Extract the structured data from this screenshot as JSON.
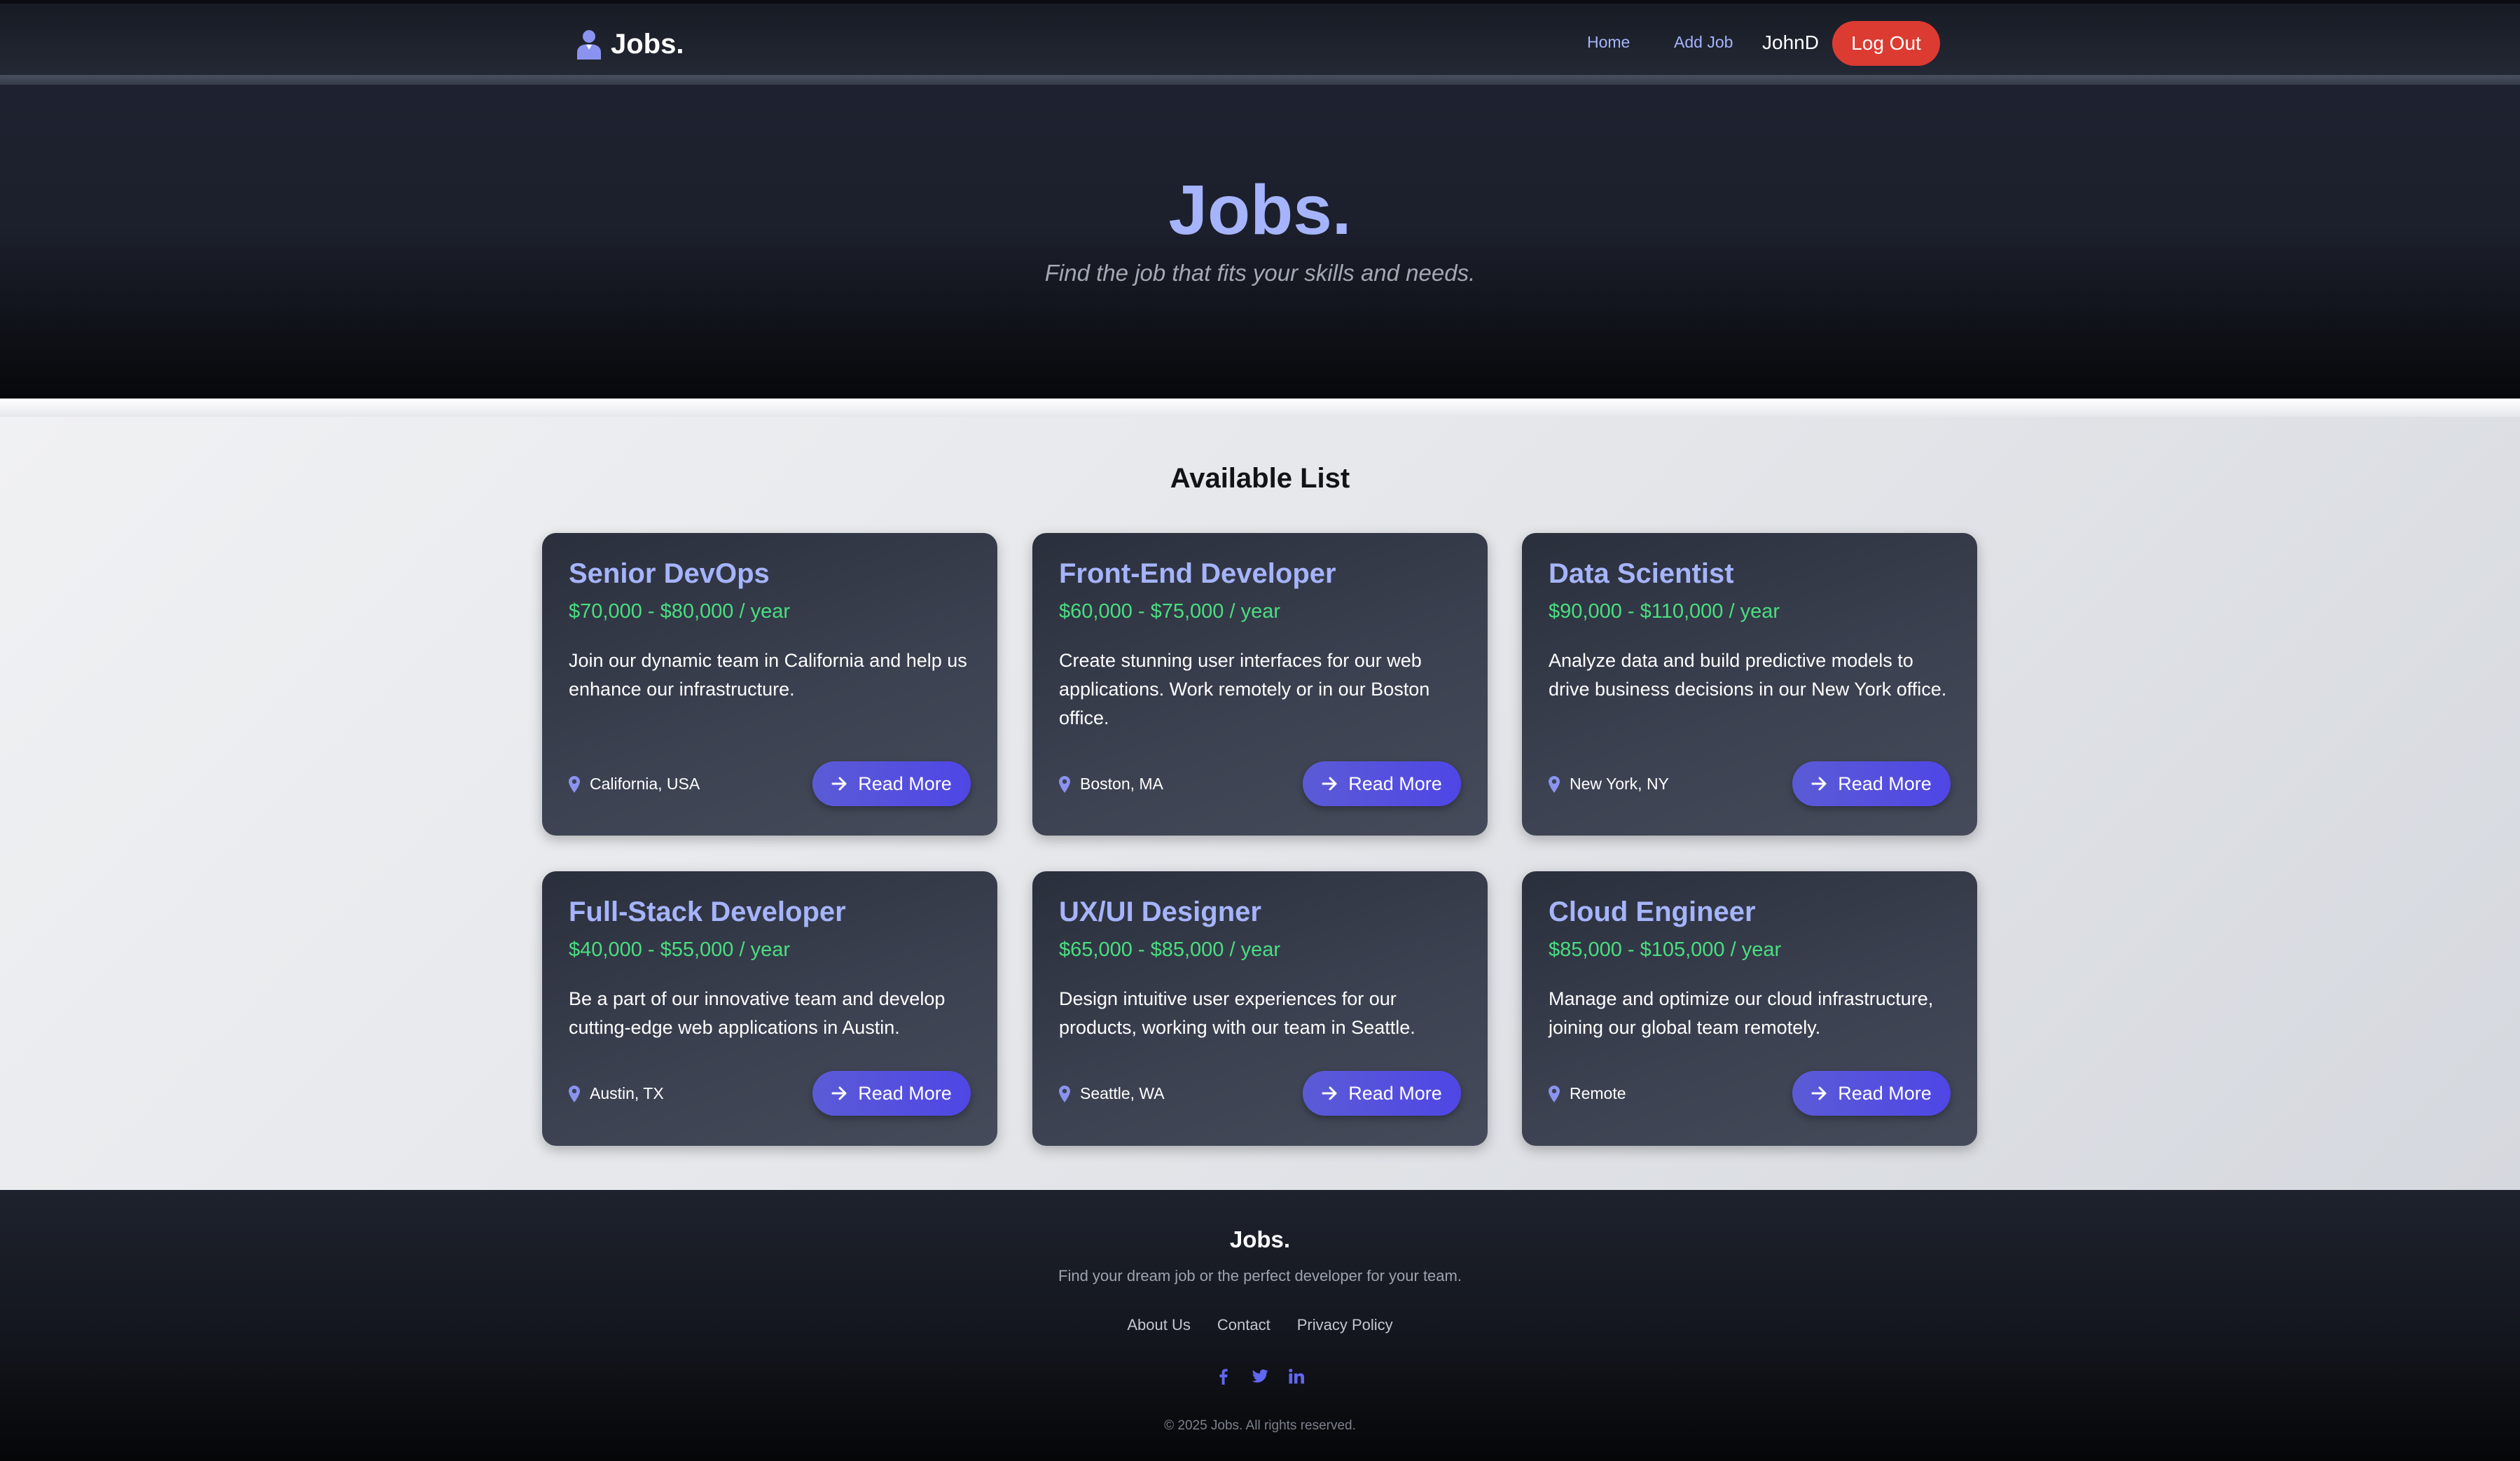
{
  "header": {
    "brand": "Jobs.",
    "nav": [
      {
        "label": "Home"
      },
      {
        "label": "Add Job"
      }
    ],
    "username": "JohnD",
    "logout_label": "Log Out"
  },
  "hero": {
    "title": "Jobs.",
    "subtitle": "Find the job that fits your skills and needs."
  },
  "main": {
    "section_title": "Available List",
    "jobs": [
      {
        "title": "Senior DevOps",
        "salary": "$70,000 - $80,000 / year",
        "description": "Join our dynamic team in California and help us enhance our infrastructure.",
        "location": "California, USA",
        "button": "Read More"
      },
      {
        "title": "Front-End Developer",
        "salary": "$60,000 - $75,000 / year",
        "description": "Create stunning user interfaces for our web applications. Work remotely or in our Boston office.",
        "location": "Boston, MA",
        "button": "Read More"
      },
      {
        "title": "Data Scientist",
        "salary": "$90,000 - $110,000 / year",
        "description": "Analyze data and build predictive models to drive business decisions in our New York office.",
        "location": "New York, NY",
        "button": "Read More"
      },
      {
        "title": "Full-Stack Developer",
        "salary": "$40,000 - $55,000 / year",
        "description": "Be a part of our innovative team and develop cutting-edge web applications in Austin.",
        "location": "Austin, TX",
        "button": "Read More"
      },
      {
        "title": "UX/UI Designer",
        "salary": "$65,000 - $85,000 / year",
        "description": "Design intuitive user experiences for our products, working with our team in Seattle.",
        "location": "Seattle, WA",
        "button": "Read More"
      },
      {
        "title": "Cloud Engineer",
        "salary": "$85,000 - $105,000 / year",
        "description": "Manage and optimize our cloud infrastructure, joining our global team remotely.",
        "location": "Remote",
        "button": "Read More"
      }
    ]
  },
  "footer": {
    "brand": "Jobs.",
    "tagline": "Find your dream job or the perfect developer for your team.",
    "links": [
      "About Us",
      "Contact",
      "Privacy Policy"
    ],
    "socials": [
      "facebook-icon",
      "twitter-icon",
      "linkedin-icon"
    ],
    "copyright": "© 2025 Jobs. All rights reserved."
  },
  "colors": {
    "accent": "#a5b4fc",
    "button": "#4f46e5",
    "logout": "#dc3b31",
    "salary": "#4ade80"
  }
}
